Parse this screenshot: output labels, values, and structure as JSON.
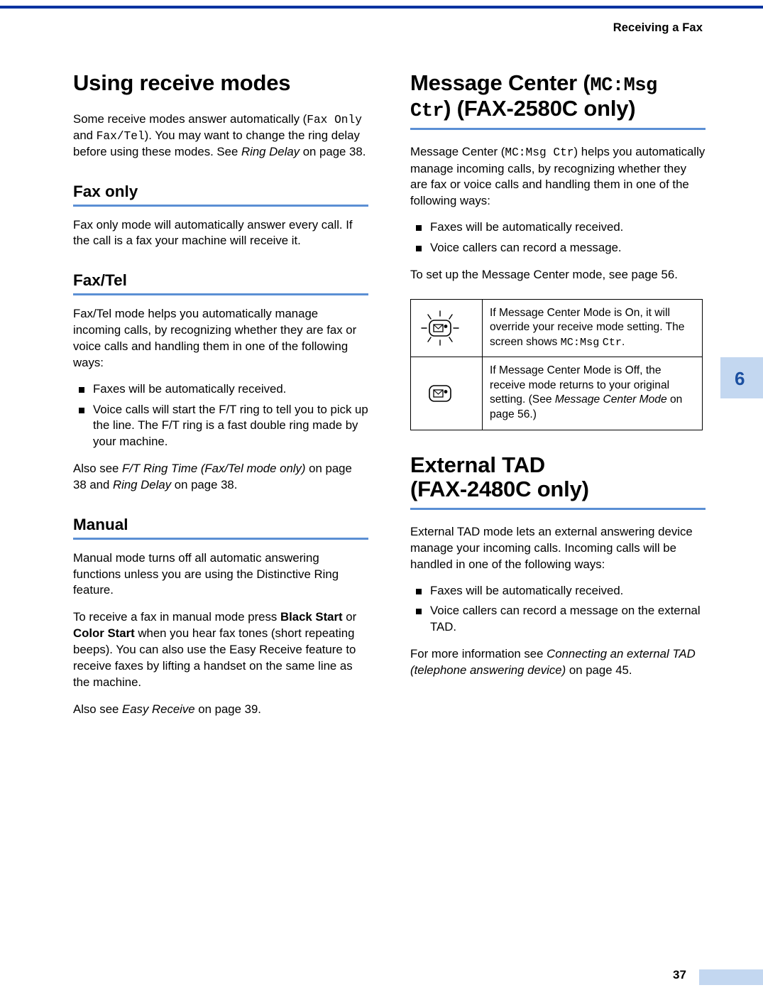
{
  "header": {
    "running_title": "Receiving a Fax",
    "chapter_number": "6",
    "page_number": "37"
  },
  "left_column": {
    "title": "Using receive modes",
    "intro_1": "Some receive modes answer automatically (",
    "intro_mono_1": "Fax Only",
    "intro_2": " and ",
    "intro_mono_2": "Fax/Tel",
    "intro_3": "). You may want to change the ring delay before using these modes. See ",
    "intro_italic": "Ring Delay",
    "intro_4": " on page 38.",
    "fax_only": {
      "heading": "Fax only",
      "body": "Fax only mode will automatically answer every call. If the call is a fax your machine will receive it."
    },
    "fax_tel": {
      "heading": "Fax/Tel",
      "body": "Fax/Tel mode helps you automatically manage incoming calls, by recognizing whether they are fax or voice calls and handling them in one of the following ways:",
      "bullets": [
        "Faxes will be automatically received.",
        "Voice calls will start the F/T ring to tell you to pick up the line. The F/T ring is a fast double ring made by your machine."
      ],
      "also_see_1": "Also see ",
      "also_see_italic_1": "F/T Ring Time (Fax/Tel mode only)",
      "also_see_2": " on page 38 and ",
      "also_see_italic_2": "Ring Delay",
      "also_see_3": " on page 38."
    },
    "manual": {
      "heading": "Manual",
      "body_1": "Manual mode turns off all automatic answering functions unless you are using the Distinctive Ring feature.",
      "body_2_a": "To receive a fax in manual mode press ",
      "body_2_bold_1": "Black Start",
      "body_2_b": " or ",
      "body_2_bold_2": "Color Start",
      "body_2_c": " when you hear fax tones (short repeating beeps). You can also use the Easy Receive feature to receive faxes by lifting a handset on the same line as the machine.",
      "also_see_1": "Also see ",
      "also_see_italic": "Easy Receive",
      "also_see_2": " on page 39."
    }
  },
  "right_column": {
    "message_center": {
      "heading_1": "Message Center (",
      "heading_mono_1": "MC:Msg",
      "heading_mono_2": "Ctr",
      "heading_2": ") (FAX-2580C only)",
      "body_1_a": "Message Center (",
      "body_1_mono": "MC:Msg Ctr",
      "body_1_b": ") helps you automatically manage incoming calls, by recognizing whether they are fax or voice calls and handling them in one of the following ways:",
      "bullets": [
        "Faxes will be automatically received.",
        "Voice callers can record a message."
      ],
      "body_2": "To set up the Message Center mode, see page 56.",
      "notes": [
        {
          "icon": "message-center-key-lit-icon",
          "text_1": "If Message Center Mode is On, it will override your receive mode setting. The screen shows ",
          "mono_1": "MC:Msg",
          "mono_2": "Ctr",
          "text_2": "."
        },
        {
          "icon": "message-center-key-off-icon",
          "text_1": "If  Message Center Mode is Off, the receive mode returns to your original setting. (See ",
          "italic": "Message Center Mode",
          "text_2": " on page 56.)"
        }
      ]
    },
    "external_tad": {
      "heading_line1": "External TAD",
      "heading_line2": "(FAX-2480C only)",
      "body_1": "External TAD mode lets an external answering device manage your incoming calls. Incoming calls will be handled in one of the following ways:",
      "bullets": [
        "Faxes will be automatically received.",
        "Voice callers can record a message on the external TAD."
      ],
      "body_2_a": "For more information see ",
      "body_2_italic": "Connecting an external TAD (telephone answering device)",
      "body_2_b": " on page 45."
    }
  },
  "colors": {
    "rule_blue": "#0033a0",
    "heading_underline": "#5b8fd4",
    "tab_blue": "#c3d7f0",
    "tab_number": "#1b4fa0"
  }
}
